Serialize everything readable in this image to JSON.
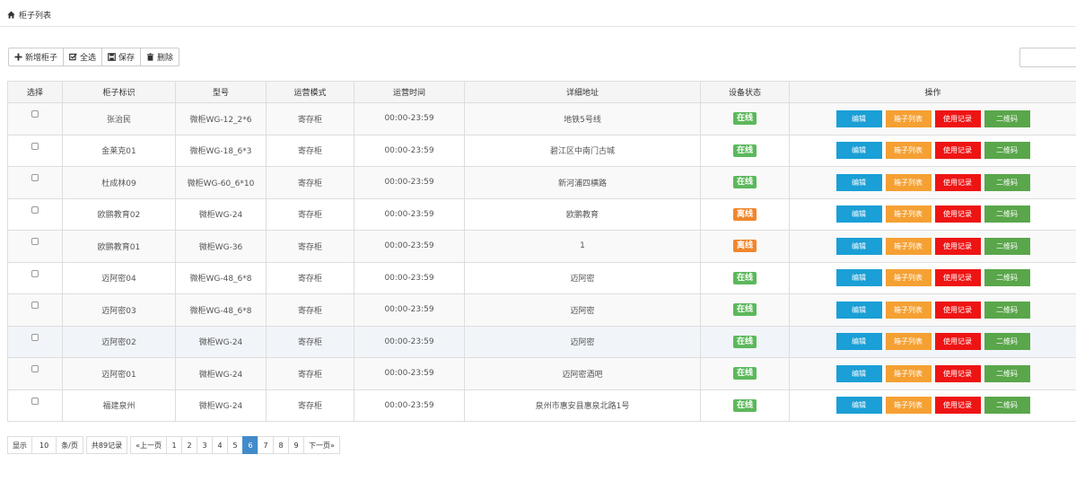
{
  "breadcrumb": {
    "icon": "home-icon",
    "title": "柜子列表"
  },
  "toolbar": {
    "add_label": "新增柜子",
    "select_all_label": "全选",
    "save_label": "保存",
    "delete_label": "删除"
  },
  "search": {
    "value": ""
  },
  "table": {
    "headers": [
      "选择",
      "柜子标识",
      "型号",
      "运营模式",
      "运营时间",
      "详细地址",
      "设备状态",
      "操作"
    ],
    "actions": [
      "编辑",
      "箱子列表",
      "使用记录",
      "二维码"
    ],
    "rows": [
      {
        "id": "张治民",
        "model": "微柜WG-12_2*6",
        "mode": "寄存柜",
        "time": "00:00-23:59",
        "address": "地铁5号线",
        "status": "在线"
      },
      {
        "id": "金莱克01",
        "model": "微柜WG-18_6*3",
        "mode": "寄存柜",
        "time": "00:00-23:59",
        "address": "碧江区中南门古城",
        "status": "在线"
      },
      {
        "id": "杜成林09",
        "model": "微柜WG-60_6*10",
        "mode": "寄存柜",
        "time": "00:00-23:59",
        "address": "新河浦四横路",
        "status": "在线"
      },
      {
        "id": "欧鹏教育02",
        "model": "微柜WG-24",
        "mode": "寄存柜",
        "time": "00:00-23:59",
        "address": "欧鹏教育",
        "status": "离线"
      },
      {
        "id": "欧鹏教育01",
        "model": "微柜WG-36",
        "mode": "寄存柜",
        "time": "00:00-23:59",
        "address": "1",
        "status": "离线"
      },
      {
        "id": "迈阿密04",
        "model": "微柜WG-48_6*8",
        "mode": "寄存柜",
        "time": "00:00-23:59",
        "address": "迈阿密",
        "status": "在线"
      },
      {
        "id": "迈阿密03",
        "model": "微柜WG-48_6*8",
        "mode": "寄存柜",
        "time": "00:00-23:59",
        "address": "迈阿密",
        "status": "在线"
      },
      {
        "id": "迈阿密02",
        "model": "微柜WG-24",
        "mode": "寄存柜",
        "time": "00:00-23:59",
        "address": "迈阿密",
        "status": "在线"
      },
      {
        "id": "迈阿密01",
        "model": "微柜WG-24",
        "mode": "寄存柜",
        "time": "00:00-23:59",
        "address": "迈阿密酒吧",
        "status": "在线"
      },
      {
        "id": "福建泉州",
        "model": "微柜WG-24",
        "mode": "寄存柜",
        "time": "00:00-23:59",
        "address": "泉州市惠安县惠泉北路1号",
        "status": "在线"
      }
    ]
  },
  "colors": {
    "online": "#5cb85c",
    "offline": "#f0862d",
    "edit": "#1a9fd6",
    "box_list": "#f5a033",
    "usage": "#ee1414",
    "qrcode": "#5aa64b",
    "page_active": "#428bca"
  },
  "pagination": {
    "show_label": "显示",
    "page_size": "10",
    "per_page_label": "条/页",
    "total_label": "共89记录",
    "prev_label": "«上一页",
    "pages": [
      "1",
      "2",
      "3",
      "4",
      "5",
      "6",
      "7",
      "8",
      "9"
    ],
    "current": "6",
    "next_label": "下一页»"
  }
}
